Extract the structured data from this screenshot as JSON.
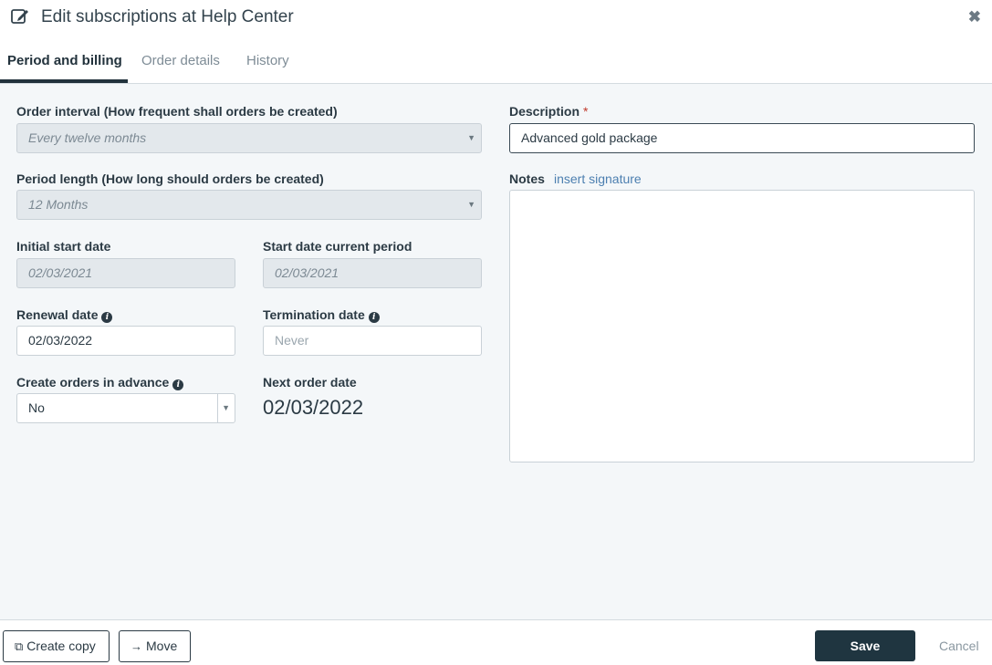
{
  "header": {
    "title": "Edit subscriptions at Help Center",
    "close_glyph": "✖"
  },
  "tabs": [
    {
      "label": "Period and billing",
      "active": true
    },
    {
      "label": "Order details",
      "active": false
    },
    {
      "label": "History",
      "active": false
    }
  ],
  "form": {
    "order_interval": {
      "label": "Order interval (How frequent shall orders be created)",
      "value": "Every twelve months"
    },
    "period_length": {
      "label": "Period length (How long should orders be created)",
      "value": "12 Months"
    },
    "initial_start_date": {
      "label": "Initial start date",
      "value": "02/03/2021"
    },
    "start_date_current_period": {
      "label": "Start date current period",
      "value": "02/03/2021"
    },
    "renewal_date": {
      "label": "Renewal date",
      "value": "02/03/2022"
    },
    "termination_date": {
      "label": "Termination date",
      "placeholder": "Never"
    },
    "create_orders_in_advance": {
      "label": "Create orders in advance",
      "value": "No"
    },
    "next_order_date": {
      "label": "Next order date",
      "value": "02/03/2022"
    },
    "description": {
      "label": "Description",
      "required_mark": "*",
      "value": "Advanced gold package"
    },
    "notes": {
      "label": "Notes",
      "link": "insert signature",
      "value": ""
    }
  },
  "footer": {
    "create_copy": "Create copy",
    "move": "Move",
    "save": "Save",
    "cancel": "Cancel"
  }
}
